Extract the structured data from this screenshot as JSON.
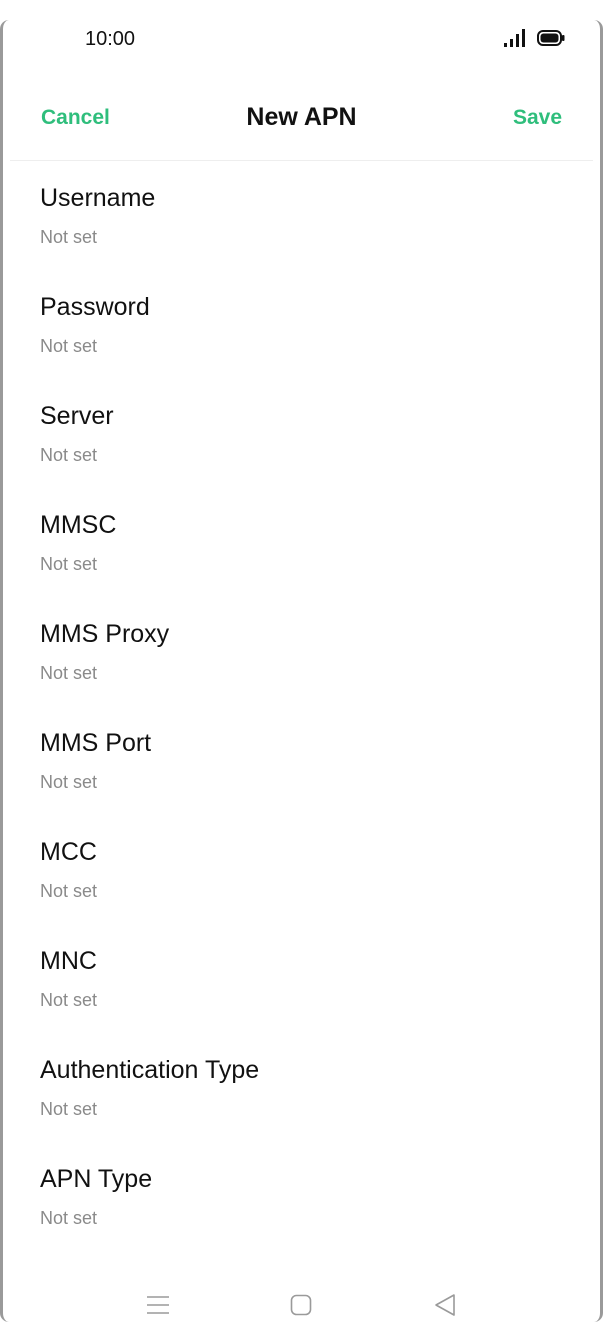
{
  "status_bar": {
    "time": "10:00",
    "signal_icon": "signal-icon",
    "battery_icon": "battery-icon"
  },
  "header": {
    "cancel_label": "Cancel",
    "title": "New APN",
    "save_label": "Save"
  },
  "settings": [
    {
      "label": "Username",
      "value": "Not set"
    },
    {
      "label": "Password",
      "value": "Not set"
    },
    {
      "label": "Server",
      "value": "Not set"
    },
    {
      "label": "MMSC",
      "value": "Not set"
    },
    {
      "label": "MMS Proxy",
      "value": "Not set"
    },
    {
      "label": "MMS Port",
      "value": "Not set"
    },
    {
      "label": "MCC",
      "value": "Not set"
    },
    {
      "label": "MNC",
      "value": "Not set"
    },
    {
      "label": "Authentication Type",
      "value": "Not set"
    },
    {
      "label": "APN Type",
      "value": "Not set"
    }
  ],
  "nav_bar": {
    "menu_icon": "menu-icon",
    "home_icon": "home-icon",
    "back_icon": "back-icon"
  },
  "colors": {
    "accent": "#2fbe7c",
    "text_primary": "#111111",
    "text_secondary": "#8a8a8a",
    "nav_icon": "#9a9a9a"
  }
}
